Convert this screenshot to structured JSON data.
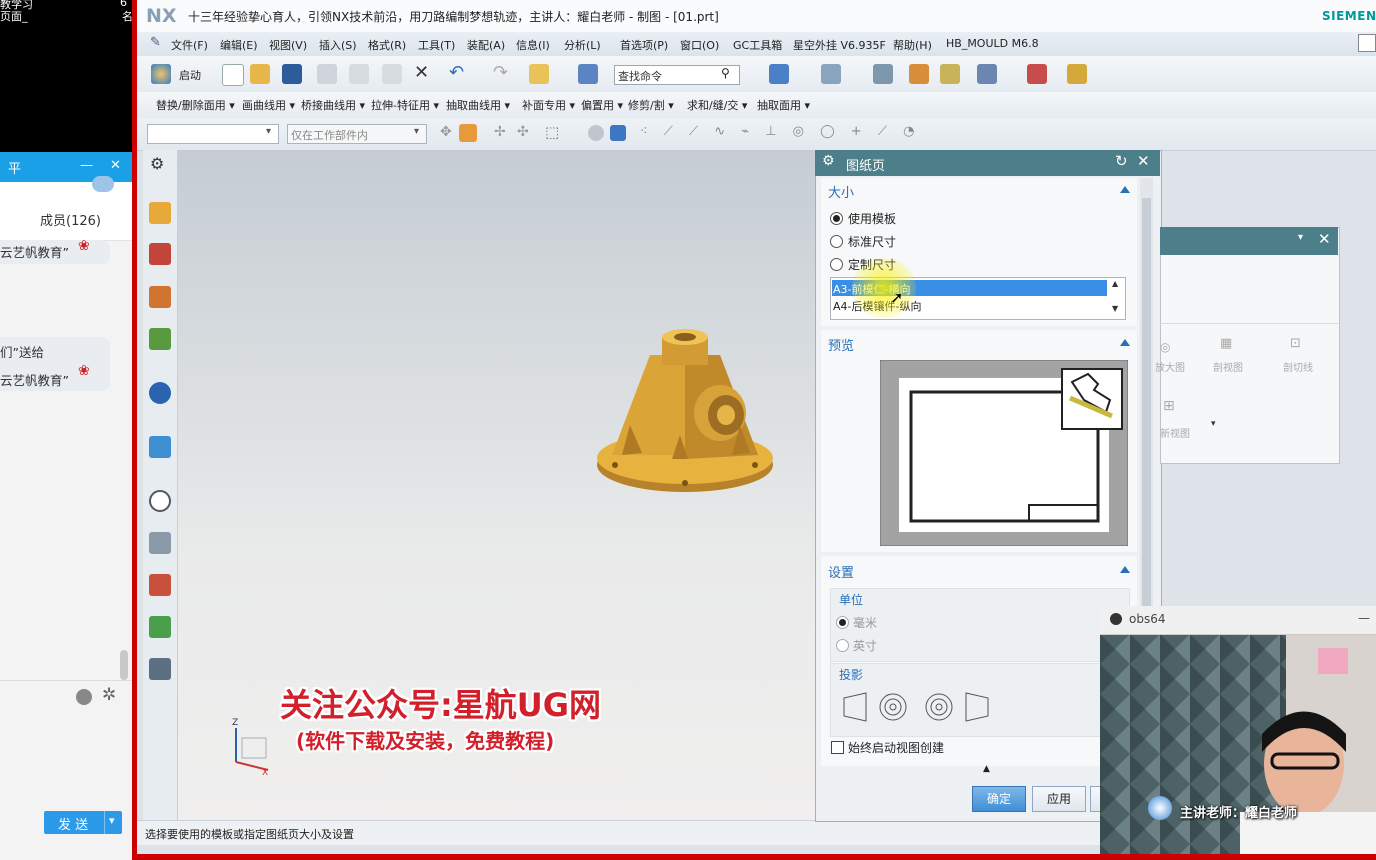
{
  "chat": {
    "top_lines": [
      "教学习",
      "页面_",
      "6",
      "名"
    ],
    "head_glyph": "平",
    "minimize": "—",
    "close": "✕",
    "members": "成员(126)",
    "messages": [
      "云艺帆教育”",
      "们”送给",
      "云艺帆教育”"
    ],
    "send_label": "发 送",
    "send_arrow": "▾"
  },
  "nx": {
    "logo": "NX",
    "title": "十三年经验挚心育人，引领NX技术前沿，用刀路编制梦想轨迹，主讲人：耀白老师 - 制图 - [01.prt]",
    "brand": "SIEMENS",
    "menu": [
      "文件(F)",
      "编辑(E)",
      "视图(V)",
      "插入(S)",
      "格式(R)",
      "工具(T)",
      "装配(A)",
      "信息(I)",
      "分析(L)",
      "首选项(P)",
      "窗口(O)",
      "GC工具箱",
      "星空外挂 V6.935F",
      "帮助(H)",
      "HB_MOULD M6.8"
    ],
    "start_label": "启动",
    "search_placeholder": "查找命令",
    "toolbar2": [
      "替换/删除面用 ▾",
      "画曲线用 ▾",
      "桥接曲线用 ▾",
      "拉伸-特征用 ▾",
      "抽取曲线用 ▾",
      "补面专用 ▾",
      "偏置用 ▾",
      "修剪/割 ▾",
      "求和/缝/交 ▾",
      "抽取面用 ▾"
    ],
    "filter_select": "",
    "scope_select": "仅在工作部件内",
    "status_text": "选择要使用的模板或指定图纸页大小及设置",
    "triad_labels": [
      "Z",
      "X"
    ]
  },
  "watermark": {
    "line1": "关注公众号:星航UG网",
    "line2": "(软件下载及安装，免费教程)"
  },
  "dialog": {
    "title": "图纸页",
    "size_section": "大小",
    "options": [
      "使用模板",
      "标准尺寸",
      "定制尺寸"
    ],
    "selected_option": 0,
    "templates": [
      "A3-前模仁-横向",
      "A4-后模镶件-纵向"
    ],
    "selected_template": 0,
    "preview_section": "预览",
    "settings_section": "设置",
    "unit_label": "单位",
    "units": [
      "毫米",
      "英寸"
    ],
    "projection_label": "投影",
    "always_create_label": "始终启动视图创建",
    "ok_label": "确定",
    "apply_label": "应用"
  },
  "popup": {
    "items": [
      "放大图",
      "剖视图",
      "剖切线",
      "新视图"
    ]
  },
  "obs": {
    "title": "obs64",
    "dash": "—",
    "caption": "主讲老师：耀白老师"
  }
}
